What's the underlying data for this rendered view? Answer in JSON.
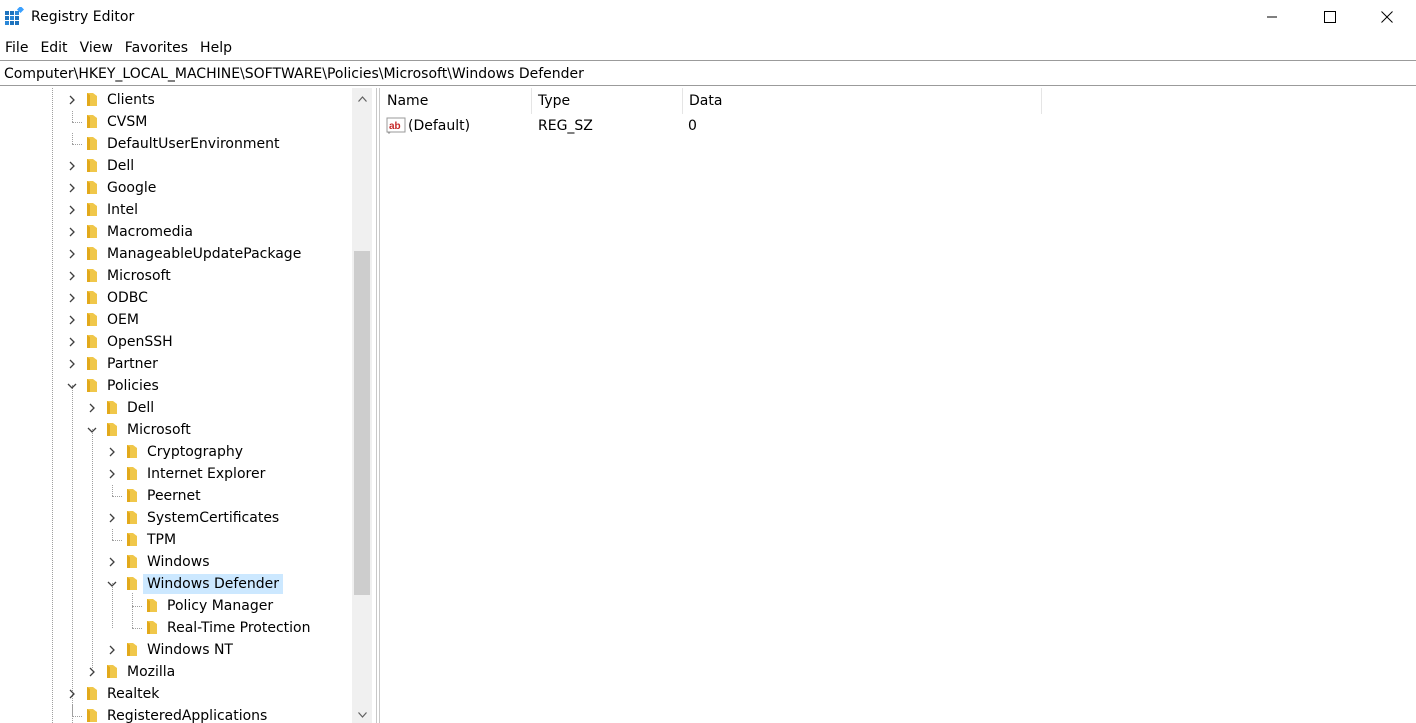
{
  "window": {
    "title": "Registry Editor"
  },
  "menu": {
    "items": [
      "File",
      "Edit",
      "View",
      "Favorites",
      "Help"
    ]
  },
  "address": {
    "path": "Computer\\HKEY_LOCAL_MACHINE\\SOFTWARE\\Policies\\Microsoft\\Windows Defender"
  },
  "tree": {
    "nodes": [
      {
        "label": "Clients",
        "level": 0,
        "expander": "collapsed"
      },
      {
        "label": "CVSM",
        "level": 0,
        "expander": "none"
      },
      {
        "label": "DefaultUserEnvironment",
        "level": 0,
        "expander": "none"
      },
      {
        "label": "Dell",
        "level": 0,
        "expander": "collapsed"
      },
      {
        "label": "Google",
        "level": 0,
        "expander": "collapsed"
      },
      {
        "label": "Intel",
        "level": 0,
        "expander": "collapsed"
      },
      {
        "label": "Macromedia",
        "level": 0,
        "expander": "collapsed"
      },
      {
        "label": "ManageableUpdatePackage",
        "level": 0,
        "expander": "collapsed"
      },
      {
        "label": "Microsoft",
        "level": 0,
        "expander": "collapsed"
      },
      {
        "label": "ODBC",
        "level": 0,
        "expander": "collapsed"
      },
      {
        "label": "OEM",
        "level": 0,
        "expander": "collapsed"
      },
      {
        "label": "OpenSSH",
        "level": 0,
        "expander": "collapsed"
      },
      {
        "label": "Partner",
        "level": 0,
        "expander": "collapsed"
      },
      {
        "label": "Policies",
        "level": 0,
        "expander": "expanded"
      },
      {
        "label": "Dell",
        "level": 1,
        "expander": "collapsed"
      },
      {
        "label": "Microsoft",
        "level": 1,
        "expander": "expanded"
      },
      {
        "label": "Cryptography",
        "level": 2,
        "expander": "collapsed"
      },
      {
        "label": "Internet Explorer",
        "level": 2,
        "expander": "collapsed"
      },
      {
        "label": "Peernet",
        "level": 2,
        "expander": "none"
      },
      {
        "label": "SystemCertificates",
        "level": 2,
        "expander": "collapsed"
      },
      {
        "label": "TPM",
        "level": 2,
        "expander": "none"
      },
      {
        "label": "Windows",
        "level": 2,
        "expander": "collapsed"
      },
      {
        "label": "Windows Defender",
        "level": 2,
        "expander": "expanded",
        "selected": true
      },
      {
        "label": "Policy Manager",
        "level": 3,
        "expander": "none"
      },
      {
        "label": "Real-Time Protection",
        "level": 3,
        "expander": "none"
      },
      {
        "label": "Windows NT",
        "level": 2,
        "expander": "collapsed"
      },
      {
        "label": "Mozilla",
        "level": 1,
        "expander": "collapsed"
      },
      {
        "label": "Realtek",
        "level": 0,
        "expander": "collapsed"
      },
      {
        "label": "RegisteredApplications",
        "level": 0,
        "expander": "none"
      }
    ]
  },
  "list": {
    "columns": [
      "Name",
      "Type",
      "Data"
    ],
    "rows": [
      {
        "name": "(Default)",
        "type": "REG_SZ",
        "data": "0",
        "icon": "string-value-icon"
      }
    ]
  },
  "colors": {
    "selection": "#cce8ff",
    "folder": "#f0c74a"
  }
}
